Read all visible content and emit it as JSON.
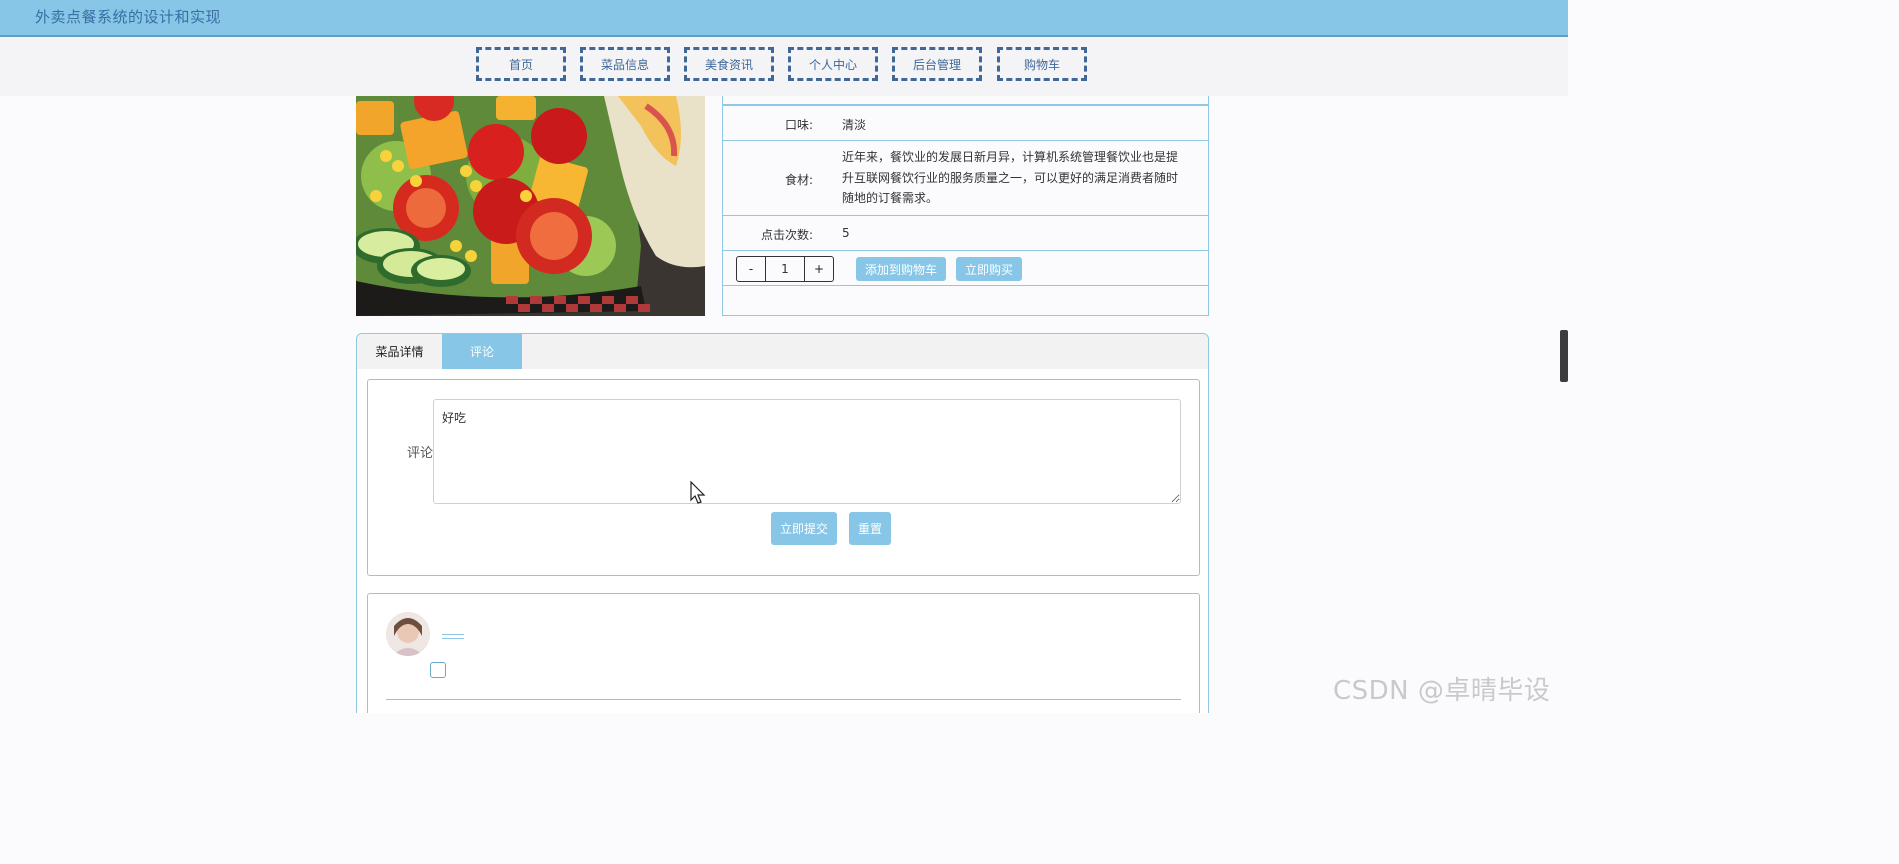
{
  "app": {
    "title": "外卖点餐系统的设计和实现"
  },
  "nav": {
    "items": [
      {
        "label": "首页"
      },
      {
        "label": "菜品信息"
      },
      {
        "label": "美食资讯"
      },
      {
        "label": "个人中心"
      },
      {
        "label": "后台管理"
      },
      {
        "label": "购物车"
      }
    ]
  },
  "detail": {
    "flavor_label": "口味:",
    "flavor_value": "清淡",
    "ingredients_label": "食材:",
    "ingredients_value": "近年来，餐饮业的发展日新月异，计算机系统管理餐饮业也是提升互联网餐饮行业的服务质量之一，可以更好的满足消费者随时随地的订餐需求。",
    "clicks_label": "点击次数:",
    "clicks_value": "5",
    "quantity": {
      "minus": "-",
      "value": "1",
      "plus": "+"
    },
    "add_to_cart": "添加到购物车",
    "buy_now": "立即购买"
  },
  "tabs": {
    "items": [
      {
        "label": "菜品详情",
        "active": false
      },
      {
        "label": "评论",
        "active": true
      }
    ]
  },
  "comment_form": {
    "label": "评论",
    "value": "好吃",
    "submit": "立即提交",
    "reset": "重置"
  },
  "watermark": "CSDN @卓晴毕设",
  "colors": {
    "accent": "#87c6e6",
    "nav_border": "#3f6898",
    "header_text": "#3a6ea5",
    "table_border": "#8fc7e4"
  }
}
